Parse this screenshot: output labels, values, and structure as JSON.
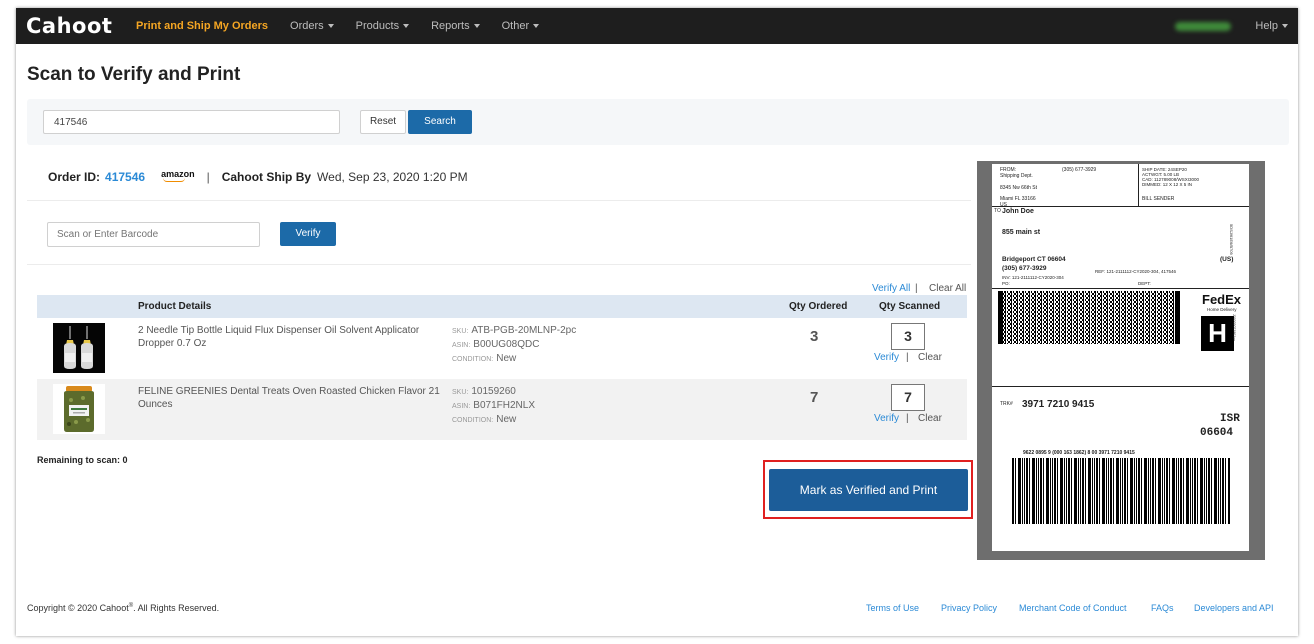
{
  "navbar": {
    "logo": "Cahoot",
    "items": [
      {
        "label": "Print and Ship My Orders",
        "active": true,
        "dropdown": false
      },
      {
        "label": "Orders",
        "dropdown": true
      },
      {
        "label": "Products",
        "dropdown": true
      },
      {
        "label": "Reports",
        "dropdown": true
      },
      {
        "label": "Other",
        "dropdown": true
      }
    ],
    "help": "Help"
  },
  "page_title": "Scan to Verify and Print",
  "search": {
    "value": "417546",
    "reset_label": "Reset",
    "search_label": "Search"
  },
  "order": {
    "id_label": "Order ID:",
    "id": "417546",
    "channel": "amazon",
    "separator": "|",
    "ship_by_label": "Cahoot Ship By",
    "ship_by": "Wed, Sep 23, 2020 1:20 PM"
  },
  "barcode": {
    "placeholder": "Scan or Enter Barcode",
    "verify_label": "Verify"
  },
  "table_actions": {
    "verify_all": "Verify All",
    "separator": "|",
    "clear_all": "Clear All"
  },
  "table": {
    "headers": {
      "product": "Product Details",
      "qty_ordered": "Qty Ordered",
      "qty_scanned": "Qty Scanned"
    },
    "rows": [
      {
        "name": "2 Needle Tip Bottle Liquid Flux Dispenser Oil Solvent Applicator Dropper 0.7 Oz",
        "sku_label": "SKU:",
        "sku": "ATB-PGB-20MLNP-2pc",
        "asin_label": "ASIN:",
        "asin": "B00UG08QDC",
        "condition_label": "CONDITION:",
        "condition": "New",
        "qty_ordered": "3",
        "qty_scanned": "3",
        "verify": "Verify",
        "sep": "|",
        "clear": "Clear"
      },
      {
        "name": "FELINE GREENIES Dental Treats Oven Roasted Chicken Flavor 21 Ounces",
        "sku_label": "SKU:",
        "sku": "10159260",
        "asin_label": "ASIN:",
        "asin": "B071FH2NLX",
        "condition_label": "CONDITION:",
        "condition": "New",
        "qty_ordered": "7",
        "qty_scanned": "7",
        "verify": "Verify",
        "sep": "|",
        "clear": "Clear"
      }
    ]
  },
  "remaining": "Remaining to scan: 0",
  "mark_button": "Mark as Verified and Print",
  "label": {
    "from": "FROM:",
    "phone_from": "(305) 677-3929",
    "from_lines": [
      "Shipping Dept.",
      "8345 Nw 66th St",
      "Miami FL 33166",
      "US"
    ],
    "ship_info": [
      "SHIP DATE: 24SEP20",
      "ACTWGT: 5.00 LB",
      "CAD: 112789008/WSXI3000",
      "DIMMED: 12 X 12 X 5 IN"
    ],
    "bill": "BILL SENDER",
    "to": "TO",
    "to_name": "John Doe",
    "to_street": "855 main st",
    "to_city": "Bridgeport CT 06604",
    "to_country": "(US)",
    "to_phone": "(305) 677-3929",
    "ref": "REF: 121-2111112-CY2020-304, 417546",
    "inv": "INV: 121-2111112-CY2020-304",
    "po": "PO:",
    "dept": "DEPT:",
    "side_code": "5DSJ/61E6/B709",
    "side_code2": "J20202071801uv",
    "carrier": "FedEx",
    "service": "Home Delivery",
    "service_letter": "H",
    "trk_label": "TRK#",
    "tracking": "3971 7210 9415",
    "isr": "ISR",
    "zip": "06604",
    "barcode_text": "9622 0895 9 (000 163 1862) 8 00 3971 7210 9415"
  },
  "footer": {
    "copyright": "Copyright © 2020 Cahoot",
    "reg": "®",
    "rights": ". All Rights Reserved.",
    "links": [
      "Terms of Use",
      "Privacy Policy",
      "Merchant Code of Conduct",
      "FAQs",
      "Developers and API"
    ]
  },
  "colors": {
    "nav_bg": "#1e1e1e",
    "accent": "#f5a623",
    "primary": "#1c6aa8",
    "link": "#2b8ad6",
    "highlight": "#e02020"
  }
}
